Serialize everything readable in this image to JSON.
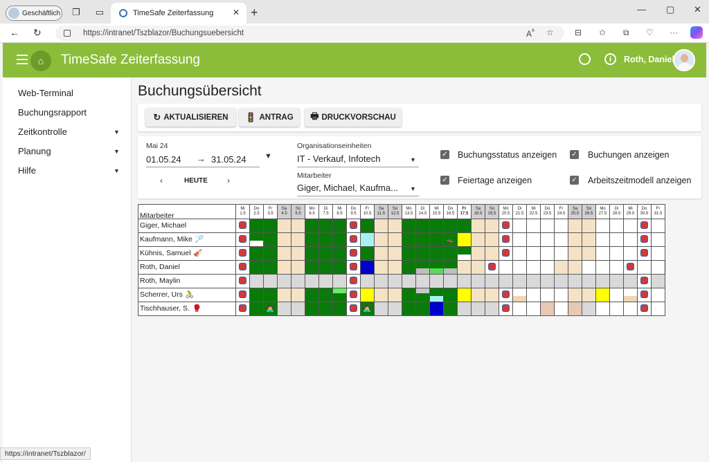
{
  "browser": {
    "profile_label": "Geschäftlich",
    "tab_title": "TimeSafe Zeiterfassung",
    "url": "https://intranet/Tszblazor/Buchungsuebersicht",
    "status_url": "https://intranet/Tszblazor/"
  },
  "header": {
    "title": "TimeSafe Zeiterfassung",
    "user_name": "Roth, Daniel"
  },
  "sidebar": {
    "items": [
      {
        "label": "Web-Terminal",
        "has_submenu": false
      },
      {
        "label": "Buchungsrapport",
        "has_submenu": false
      },
      {
        "label": "Zeitkontrolle",
        "has_submenu": true
      },
      {
        "label": "Planung",
        "has_submenu": true
      },
      {
        "label": "Hilfe",
        "has_submenu": true
      }
    ]
  },
  "page": {
    "title": "Buchungsübersicht"
  },
  "toolbar": {
    "refresh_label": "AKTUALISIEREN",
    "request_label": "ANTRAG",
    "print_label": "DRUCKVORSCHAU"
  },
  "filters": {
    "month_label": "Mai 24",
    "date_from": "01.05.24",
    "arrow": "→",
    "date_to": "31.05.24",
    "today_label": "HEUTE",
    "org_label": "Organisationseinheiten",
    "org_value": "IT - Verkauf, Infotech",
    "employee_label": "Mitarbeiter",
    "employee_value": "Giger, Michael, Kaufma...",
    "checkboxes": [
      {
        "label": "Buchungsstatus anzeigen",
        "checked": true
      },
      {
        "label": "Buchungen anzeigen",
        "checked": true
      },
      {
        "label": "Feiertage anzeigen",
        "checked": true
      },
      {
        "label": "Arbeitszeitmodell anzeigen",
        "checked": true
      }
    ]
  },
  "grid": {
    "name_header": "Mitarbeiter",
    "days": [
      {
        "dow": "Mi",
        "date": "1.5"
      },
      {
        "dow": "Do",
        "date": "2.5"
      },
      {
        "dow": "Fr",
        "date": "3.5"
      },
      {
        "dow": "Sa",
        "date": "4.5"
      },
      {
        "dow": "So",
        "date": "5.5"
      },
      {
        "dow": "Mo",
        "date": "6.5"
      },
      {
        "dow": "Di",
        "date": "7.5"
      },
      {
        "dow": "Mi",
        "date": "8.5"
      },
      {
        "dow": "Do",
        "date": "9.5"
      },
      {
        "dow": "Fr",
        "date": "10.5"
      },
      {
        "dow": "Sa",
        "date": "11.5"
      },
      {
        "dow": "So",
        "date": "12.5"
      },
      {
        "dow": "Mo",
        "date": "13.5"
      },
      {
        "dow": "Di",
        "date": "14.5"
      },
      {
        "dow": "Mi",
        "date": "15.5"
      },
      {
        "dow": "Do",
        "date": "16.5"
      },
      {
        "dow": "Fr",
        "date": "17.5"
      },
      {
        "dow": "Sa",
        "date": "18.5"
      },
      {
        "dow": "So",
        "date": "19.5"
      },
      {
        "dow": "Mo",
        "date": "20.5"
      },
      {
        "dow": "Di",
        "date": "21.5"
      },
      {
        "dow": "Mi",
        "date": "22.5"
      },
      {
        "dow": "Do",
        "date": "23.5"
      },
      {
        "dow": "Fr",
        "date": "24.5"
      },
      {
        "dow": "Sa",
        "date": "25.5"
      },
      {
        "dow": "So",
        "date": "26.5"
      },
      {
        "dow": "Mo",
        "date": "27.5"
      },
      {
        "dow": "Di",
        "date": "28.5"
      },
      {
        "dow": "Mi",
        "date": "29.5"
      },
      {
        "dow": "Do",
        "date": "30.5"
      },
      {
        "dow": "Fr",
        "date": "31.5"
      }
    ],
    "weekend_columns": [
      3,
      4,
      10,
      11,
      17,
      18,
      24,
      25
    ],
    "today_column": 16,
    "employees": [
      {
        "name": "Giger, Michael",
        "emoji": "",
        "bold": false,
        "cells": [
          "h",
          "g",
          "g",
          "we",
          "we",
          "g",
          "g",
          "g",
          "h",
          "g",
          "we",
          "we",
          "g",
          "g",
          "g",
          "g",
          "g",
          "we",
          "we",
          "h",
          "w",
          "w",
          "w",
          "w",
          "we",
          "we",
          "w",
          "w",
          "w",
          "h",
          "w"
        ]
      },
      {
        "name": "Kaufmann, Mike",
        "emoji": "🏸",
        "bold": false,
        "cells": [
          "h",
          "g|wb",
          "g",
          "we",
          "we",
          "g",
          "g",
          "g",
          "h",
          "c",
          "we",
          "we",
          "g",
          "g",
          "g",
          "g|sh",
          "y",
          "we",
          "we",
          "h",
          "w",
          "w",
          "w",
          "w",
          "we",
          "we",
          "w",
          "w",
          "w",
          "h",
          "w"
        ]
      },
      {
        "name": "Kühnis, Samuel",
        "emoji": "🎻",
        "bold": false,
        "cells": [
          "h",
          "g",
          "g",
          "we",
          "we",
          "g",
          "g",
          "g",
          "h",
          "g",
          "we",
          "we",
          "g",
          "g",
          "g",
          "g",
          "g|wb",
          "we",
          "we",
          "h",
          "w",
          "w",
          "w",
          "w",
          "we",
          "we",
          "w",
          "w",
          "w",
          "h",
          "w"
        ]
      },
      {
        "name": "Roth, Daniel",
        "emoji": "",
        "bold": true,
        "cells": [
          "h",
          "g",
          "g",
          "we",
          "we",
          "g",
          "g",
          "g",
          "h",
          "b",
          "we",
          "we",
          "g",
          "g|grb",
          "g|lgb",
          "g|grb",
          "we",
          "we",
          "h",
          "w",
          "w",
          "w",
          "w",
          "we",
          "we",
          "w",
          "w",
          "w",
          "h",
          "w"
        ]
      },
      {
        "name": "Roth, Maylin",
        "emoji": "",
        "bold": false,
        "cells": [
          "h",
          "gr",
          "gr",
          "gr",
          "gr",
          "gr",
          "gr",
          "gr",
          "h",
          "gr",
          "gr",
          "gr",
          "gr",
          "gr",
          "gr",
          "gr",
          "gr",
          "gr",
          "gr",
          "gr",
          "gr",
          "gr",
          "gr",
          "gr",
          "gr",
          "gr",
          "gr",
          "gr",
          "gr",
          "h",
          "gr"
        ]
      },
      {
        "name": "Scherrer, Urs",
        "emoji": "🚴",
        "bold": false,
        "cells": [
          "h",
          "g",
          "g",
          "we",
          "we",
          "g",
          "g",
          "g|lgt",
          "h",
          "y",
          "we",
          "we",
          "g",
          "g|grt",
          "g|cb",
          "g",
          "y",
          "we",
          "we",
          "h",
          "w|peb",
          "w",
          "w",
          "w",
          "we",
          "we",
          "y",
          "w",
          "w|peb",
          "h",
          "w"
        ]
      },
      {
        "name": "Tischhauser, S.",
        "emoji": "🥊",
        "bold": false,
        "cells": [
          "h",
          "g",
          "g|pic",
          "gr",
          "gr",
          "g",
          "g",
          "g",
          "h",
          "g|pic",
          "gr",
          "gr",
          "g",
          "g",
          "b",
          "g",
          "gr",
          "gr",
          "gr",
          "h",
          "w",
          "w",
          "p",
          "w",
          "p",
          "gr",
          "w",
          "w",
          "w",
          "h",
          "w"
        ]
      }
    ]
  }
}
